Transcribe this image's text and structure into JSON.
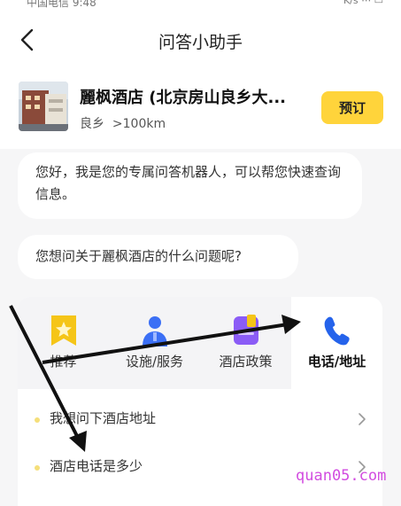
{
  "nav": {
    "title": "问答小助手",
    "back_icon": "chevron-left-icon"
  },
  "hotel": {
    "name": "麗枫酒店 (北京房山良乡大...",
    "area": "良乡",
    "distance": ">100km",
    "book_label": "预订"
  },
  "chat": {
    "greeting": "您好，我是您的专属问答机器人，可以帮您快速查询信息。",
    "prompt": "您想问关于麗枫酒店的什么问题呢?"
  },
  "tabs": [
    {
      "label": "推荐",
      "icon": "star-bookmark-icon",
      "color": "#f5c518"
    },
    {
      "label": "设施/服务",
      "icon": "staff-person-icon",
      "color": "#3b6ff5"
    },
    {
      "label": "酒店政策",
      "icon": "policy-document-icon",
      "color": "#8b5cf6"
    },
    {
      "label": "电话/地址",
      "icon": "phone-icon",
      "color": "#2563eb",
      "active": true
    }
  ],
  "questions": [
    {
      "text": "我想问下酒店地址"
    },
    {
      "text": "酒店电话是多少"
    }
  ],
  "watermark": "quan05.com",
  "colors": {
    "accent": "#ffd43b",
    "background": "#f6f6f7",
    "watermark": "#d24ce0"
  }
}
